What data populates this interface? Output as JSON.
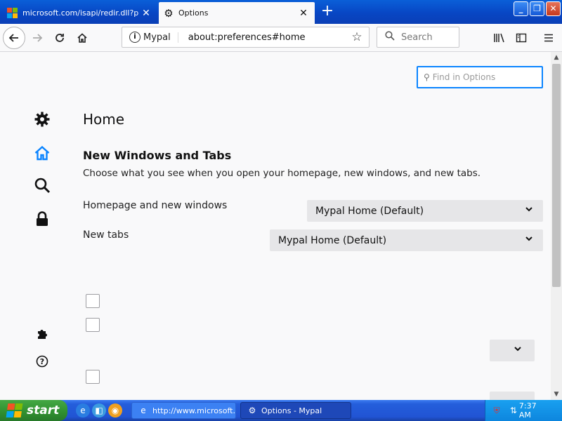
{
  "browser": {
    "tabs": [
      {
        "title": "microsoft.com/isapi/redir.dll?prd=i",
        "active": false
      },
      {
        "title": "Options",
        "active": true
      }
    ],
    "new_tab_icon": "plus-icon",
    "urlbar": {
      "site": "Mypal",
      "url": "about:preferences#home"
    },
    "search": {
      "placeholder": "Search"
    }
  },
  "page": {
    "find_placeholder": "Find in Options",
    "title": "Home",
    "section_title": "New Windows and Tabs",
    "section_desc": "Choose what you see when you open your homepage, new windows, and new tabs.",
    "homepage_label": "Homepage and new windows",
    "homepage_value": "Mypal Home (Default)",
    "newtabs_label": "New tabs",
    "newtabs_value": "Mypal Home (Default)",
    "categories": [
      "gear-icon",
      "home-icon",
      "search-icon",
      "lock-icon"
    ],
    "footer_icons": [
      "extensions-icon",
      "help-icon"
    ]
  },
  "taskbar": {
    "start_label": "start",
    "tasks": [
      {
        "label": "http://www.microsoft...."
      },
      {
        "label": "Options - Mypal"
      }
    ],
    "clock": "7:37 AM"
  },
  "colors": {
    "accent": "#0a84ff",
    "taskbar": "#245edb",
    "start": "#2f8f2f"
  }
}
